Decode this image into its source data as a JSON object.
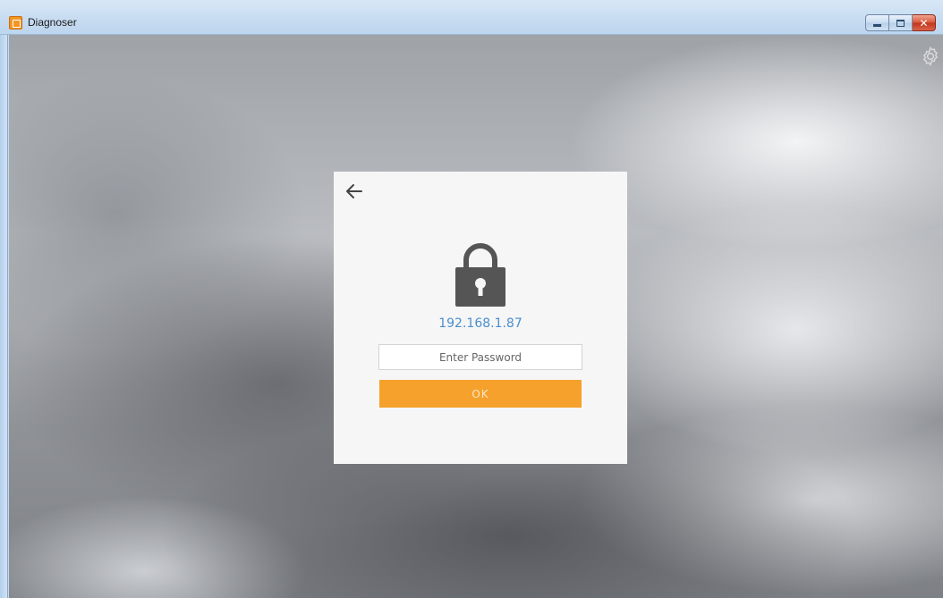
{
  "window": {
    "title": "Diagnoser",
    "controls": {
      "minimize_icon": "minimize-icon",
      "maximize_icon": "maximize-icon",
      "close_glyph": "✕"
    }
  },
  "toolbar": {
    "settings_icon": "gear-icon"
  },
  "dialog": {
    "back_icon": "arrow-left-icon",
    "lock_icon": "lock-icon",
    "host_address": "192.168.1.87",
    "password_input": {
      "value": "",
      "placeholder": "Enter Password"
    },
    "ok_label": "OK"
  },
  "colors": {
    "accent_orange": "#f5a12c",
    "link_blue": "#4a8fd0",
    "lock_gray": "#555555"
  }
}
